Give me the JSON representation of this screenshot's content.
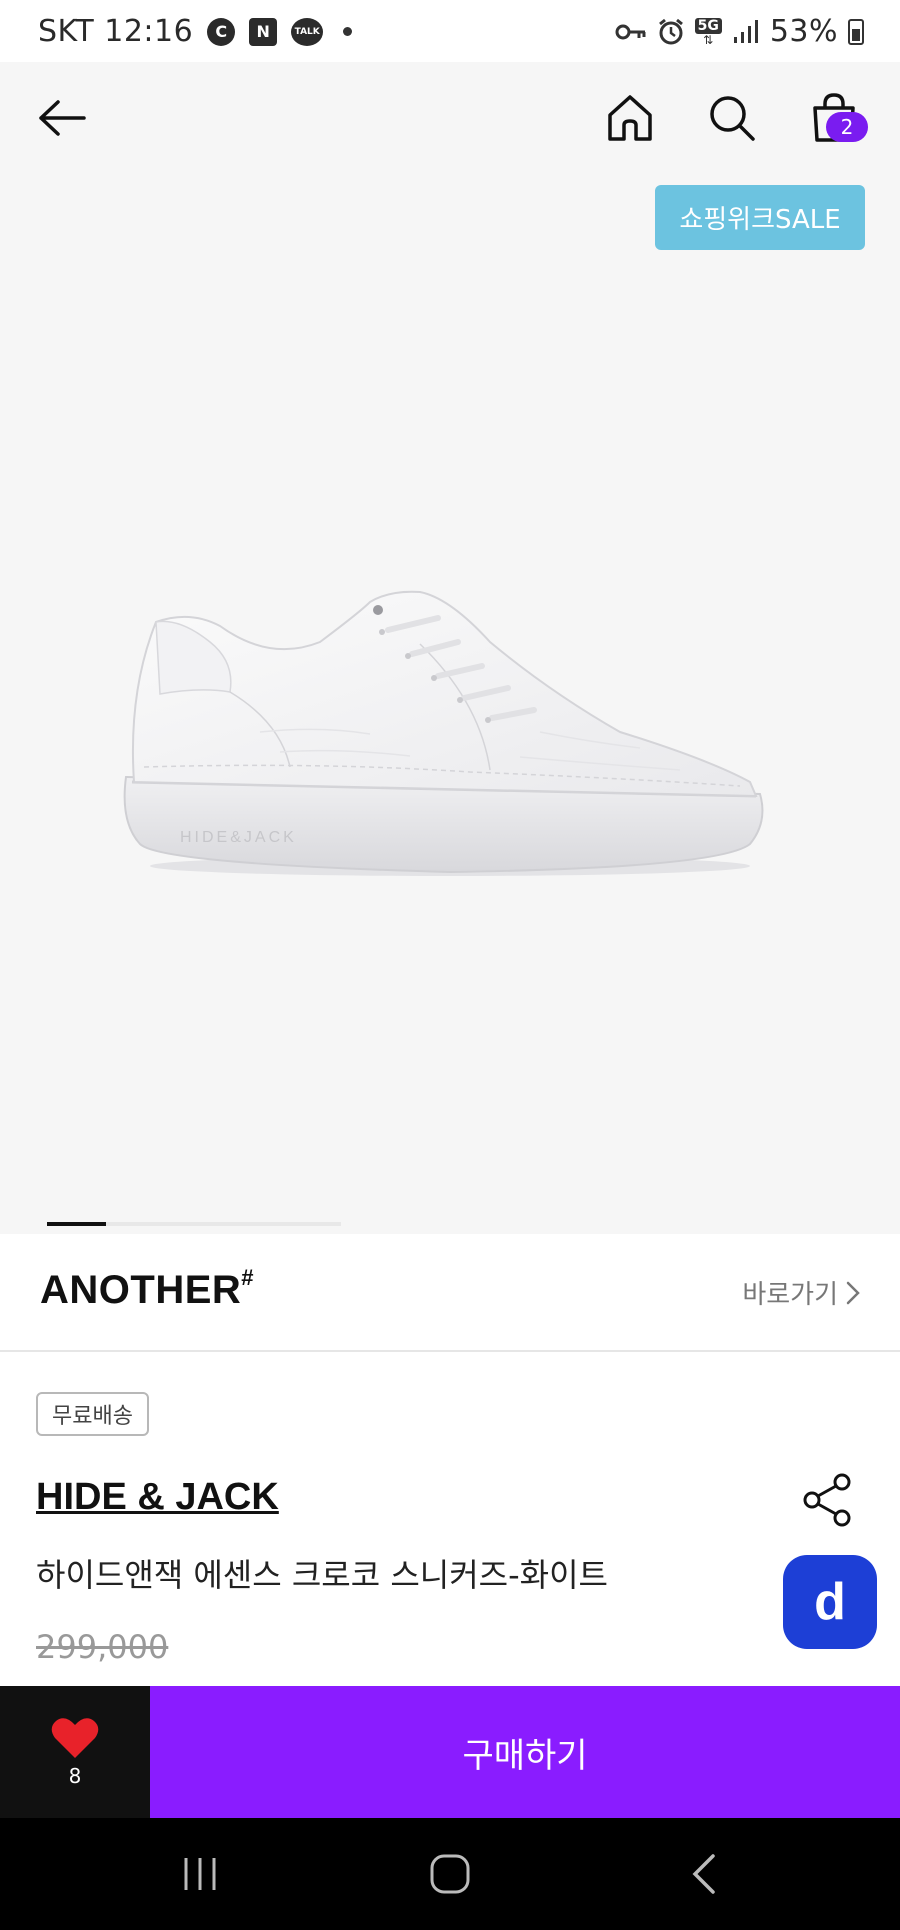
{
  "status_bar": {
    "carrier_time": "SKT 12:16",
    "icons": [
      "c-icon",
      "naver-icon",
      "kakaotalk-icon",
      "dot-icon"
    ],
    "talk_label": "TALK",
    "c_label": "C",
    "n_label": "N",
    "net_label": "5G",
    "battery": "53%"
  },
  "top_nav": {
    "cart_count": "2"
  },
  "hero": {
    "sale_label": "쇼핑위크SALE",
    "image_index": 1,
    "image_total": 5
  },
  "brand_row": {
    "logo_text": "ANOTHER",
    "logo_mark": "#",
    "goto_label": "바로가기"
  },
  "product": {
    "free_shipping": "무료배송",
    "brand": "HIDE & JACK",
    "name": "하이드앤잭 에센스 크로코 스니커즈-화이트",
    "original_price": "299,000",
    "fab_label": "d"
  },
  "buy_bar": {
    "like_count": "8",
    "buy_label": "구매하기"
  },
  "colors": {
    "accent": "#8a1cff",
    "sale_badge": "#6cc3e0",
    "fab": "#1d3fd6",
    "like_heart": "#e8222a"
  }
}
